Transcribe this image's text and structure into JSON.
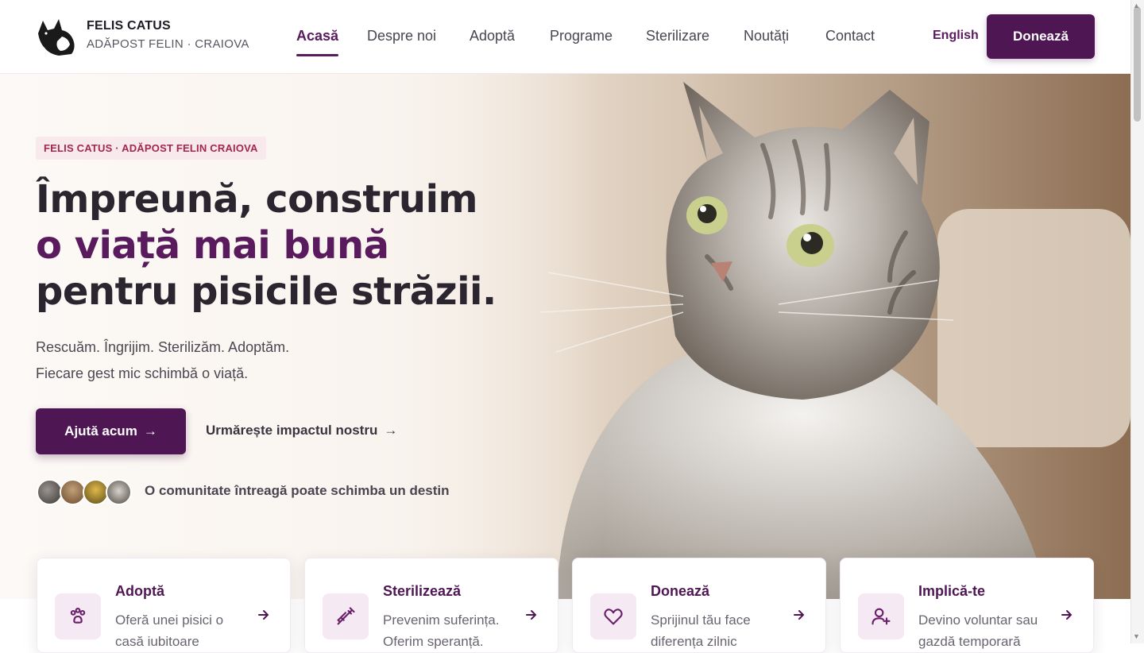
{
  "brand": {
    "title": "FELIS CATUS",
    "subtitle": "ADĂPOST FELIN · CRAIOVA"
  },
  "nav": {
    "items": [
      {
        "label": "Acasă",
        "active": true
      },
      {
        "label": "Despre noi"
      },
      {
        "label": "Adoptă"
      },
      {
        "label": "Programe"
      },
      {
        "label": "Sterilizare"
      },
      {
        "label": "Noutăți"
      },
      {
        "label": "Contact"
      }
    ],
    "language": "English",
    "donate": "Donează"
  },
  "hero": {
    "eyebrow": "FELIS CATUS · ADĂPOST FELIN CRAIOVA",
    "headline_line1": "Împreună, construim",
    "headline_line2": "o viață mai bună",
    "headline_line3": "pentru pisicile străzii.",
    "subtext_line1": "Rescuăm. Îngrijim. Sterilizăm. Adoptăm.",
    "subtext_line2": "Fiecare gest mic schimbă o viață.",
    "cta_primary": "Ajută acum",
    "cta_secondary": "Urmărește impactul nostru",
    "community": "O comunitate întreagă poate schimba un destin"
  },
  "cards": [
    {
      "title": "Adoptă",
      "text": "Oferă unei pisici o casă iubitoare",
      "icon": "paw-icon"
    },
    {
      "title": "Sterilizează",
      "text": "Prevenim suferința. Oferim speranță.",
      "icon": "syringe-icon"
    },
    {
      "title": "Donează",
      "text": "Sprijinul tău face diferența zilnic",
      "icon": "heart-icon"
    },
    {
      "title": "Implică-te",
      "text": "Devino voluntar sau gazdă temporară",
      "icon": "user-plus-icon"
    }
  ],
  "colors": {
    "accent": "#5a1a5e",
    "button": "#4f1654",
    "eyebrow_text": "#a3284e",
    "eyebrow_bg": "#f7e9ec"
  }
}
